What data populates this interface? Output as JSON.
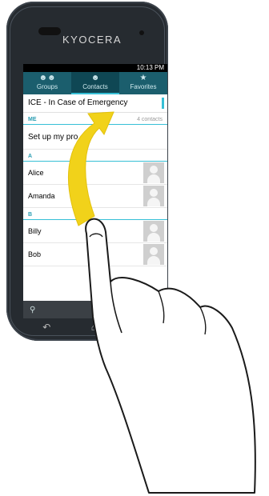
{
  "device": {
    "brand": "KYOCERA"
  },
  "status": {
    "time": "10:13 PM"
  },
  "tabs": [
    {
      "label": "Groups",
      "icon": "groups-icon"
    },
    {
      "label": "Contacts",
      "icon": "person-icon"
    },
    {
      "label": "Favorites",
      "icon": "star-icon"
    }
  ],
  "ice": {
    "label": "ICE - In Case of Emergency"
  },
  "me": {
    "header": "ME",
    "count": "4 contacts",
    "setup": "Set up my pro"
  },
  "sections": [
    {
      "letter": "A",
      "contacts": [
        "Alice",
        "Amanda"
      ]
    },
    {
      "letter": "B",
      "contacts": [
        "Billy",
        "Bob"
      ]
    }
  ],
  "colors": {
    "tab_bar": "#1b5e6d",
    "accent": "#36bfd6",
    "arrow": "#f1d21a",
    "bezel": "#262b30"
  }
}
